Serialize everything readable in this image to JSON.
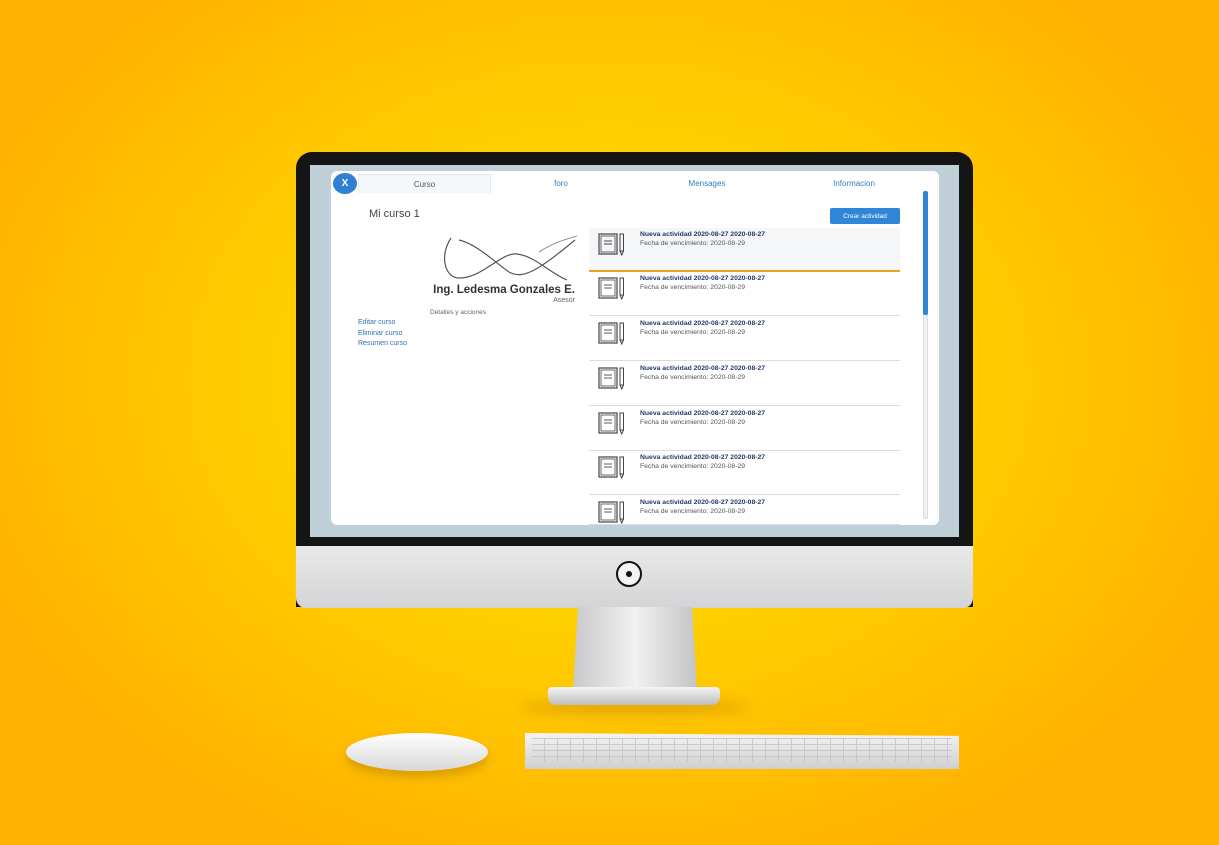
{
  "tabs": [
    {
      "label": "Curso",
      "active": true
    },
    {
      "label": "foro",
      "active": false
    },
    {
      "label": "Mensages",
      "active": false
    },
    {
      "label": "Informacion",
      "active": false
    }
  ],
  "close_label": "X",
  "course": {
    "title": "Mi curso 1"
  },
  "professor": {
    "name": "Ing. Ledesma Gonzales E.",
    "role": "Asesor"
  },
  "details_label": "Detalles y acciones",
  "side_links": [
    "Editar curso",
    "Eliminar curso",
    "Resumen curso"
  ],
  "create_button": "Crear actividad",
  "activities": [
    {
      "title": "Nueva actividad 2020-08-27 2020-08-27",
      "due": "Fecha de vencimiento: 2020-08-29"
    },
    {
      "title": "Nueva actividad 2020-08-27 2020-08-27",
      "due": "Fecha de vencimiento: 2020-08-29"
    },
    {
      "title": "Nueva actividad 2020-08-27 2020-08-27",
      "due": "Fecha de vencimiento: 2020-08-29"
    },
    {
      "title": "Nueva actividad 2020-08-27 2020-08-27",
      "due": "Fecha de vencimiento: 2020-08-29"
    },
    {
      "title": "Nueva actividad 2020-08-27 2020-08-27",
      "due": "Fecha de vencimiento: 2020-08-29"
    },
    {
      "title": "Nueva actividad 2020-08-27 2020-08-27",
      "due": "Fecha de vencimiento: 2020-08-29"
    },
    {
      "title": "Nueva actividad 2020-08-27 2020-08-27",
      "due": "Fecha de vencimiento: 2020-08-29"
    }
  ],
  "colors": {
    "accent": "#2f86d6",
    "background": "#ffd400",
    "active_border": "#f0a020"
  }
}
